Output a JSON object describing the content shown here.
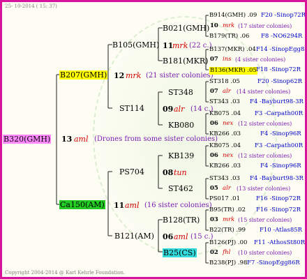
{
  "header": {
    "date": "25- 10-2014 ( 15: 37)"
  },
  "footer": {
    "copyright": "Copyright 2004-2014 @ Karl Kehrle Foundation."
  },
  "root": {
    "name": "B320(GMH)",
    "number": "13",
    "abbr": "aml",
    "desc": "(Drones from some sister colonies)"
  },
  "gen1": [
    {
      "name": "B207(GMH)",
      "number": "12",
      "abbr": "mrk",
      "desc": "(21 sister colonies)"
    },
    {
      "name": "Ca150(AM)",
      "number": "11",
      "abbr": "aml",
      "desc": "(16 sister colonies)"
    }
  ],
  "gen2": [
    {
      "name": "B105(GMH)",
      "number": "11",
      "abbr": "mrk",
      "desc": "(22 c.)"
    },
    {
      "name": "ST114",
      "number": "09",
      "abbr": "alr",
      "desc": "(14 c.)"
    },
    {
      "name": "PS704",
      "number": "08",
      "abbr": "tun",
      "desc": ""
    },
    {
      "name": "B121(AM)",
      "number": "06",
      "abbr": "aml",
      "desc": "(15 c.)"
    }
  ],
  "gen3": [
    "B021(GMH)",
    "B181(MKR)",
    "ST348",
    "KB080",
    "KB139",
    "ST462",
    "B128(TR)",
    "B25(CS)"
  ],
  "gen4": [
    {
      "father": "B914(GMH) .09",
      "fcode": "F20 -Sinop72R",
      "number": "10",
      "abbr": "mrk",
      "desc": "(17 sister colonies)",
      "mother": "B179(TR) .06",
      "mcode": "F8 -NO6294R"
    },
    {
      "father": "B137(MKR) .04",
      "fcode": "F14 -SinopEgg86R",
      "number": "07",
      "abbr": "ins",
      "desc": "(4 sister colonies)",
      "mother": "B136(MKR) .05",
      "mcode": "F18 -Sinop72R"
    },
    {
      "father": "ST318 .05",
      "fcode": "F20 -Sinop62R",
      "number": "07",
      "abbr": "alr",
      "desc": "(14 sister colonies)",
      "mother": "ST343 .03",
      "mcode": "F4 -Bayburt98-3R"
    },
    {
      "father": "KB075 .04",
      "fcode": "F3 -Carpath00R",
      "number": "06",
      "abbr": "nex",
      "desc": "(12 sister colonies)",
      "mother": "KB266 .03",
      "mcode": "F4 -Sinop96R"
    },
    {
      "father": "KB075 .04",
      "fcode": "F3 -Carpath00R",
      "number": "06",
      "abbr": "nex",
      "desc": "(12 sister colonies)",
      "mother": "KB266 .03",
      "mcode": "F4 -Sinop96R"
    },
    {
      "father": "ST343 .03",
      "fcode": "F4 -Bayburt98-3R",
      "number": "05",
      "abbr": "alr",
      "desc": "(13 sister colonies)",
      "mother": "PS017 .01",
      "mcode": "F16 -Sinop72R"
    },
    {
      "father": "B95(TR) .02",
      "fcode": "F16 -Sinop72R",
      "number": "03",
      "abbr": "mrk",
      "desc": "(15 sister colonies)",
      "mother": "B22(TR) .99",
      "mcode": "F10 -Atlas85R"
    },
    {
      "father": "B126(PJ) .00",
      "fcode": "F11 -AthosSt80R",
      "number": "02",
      "abbr": "fhl",
      "desc": "(10 sister colonies)",
      "mother": "B238(PJ) .98",
      "mcode": "F7 -SinopEgg86R"
    }
  ]
}
